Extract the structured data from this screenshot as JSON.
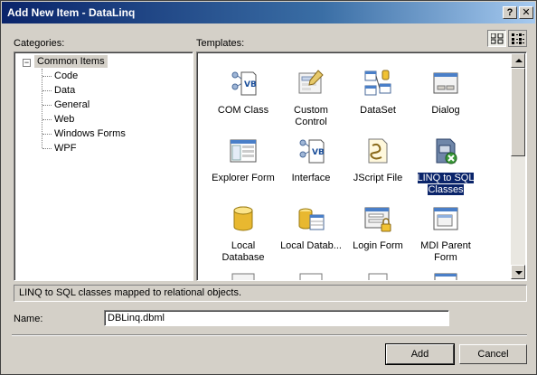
{
  "window": {
    "title": "Add New Item - DataLinq",
    "help_label": "?",
    "close_label": "✕"
  },
  "categories": {
    "label": "Categories:",
    "root": {
      "toggle": "−",
      "label": "Common Items"
    },
    "items": [
      {
        "label": "Code"
      },
      {
        "label": "Data"
      },
      {
        "label": "General"
      },
      {
        "label": "Web"
      },
      {
        "label": "Windows Forms"
      },
      {
        "label": "WPF"
      }
    ]
  },
  "templates": {
    "label": "Templates:",
    "view_modes": [
      "large-icons",
      "small-icons"
    ],
    "selected": "LINQ to SQL Classes",
    "items": [
      {
        "label": "COM Class",
        "icon": "vb-class-icon"
      },
      {
        "label": "Custom Control",
        "icon": "custom-control-icon"
      },
      {
        "label": "DataSet",
        "icon": "dataset-icon"
      },
      {
        "label": "Dialog",
        "icon": "dialog-icon"
      },
      {
        "label": "Explorer Form",
        "icon": "explorer-form-icon"
      },
      {
        "label": "Interface",
        "icon": "interface-icon"
      },
      {
        "label": "JScript File",
        "icon": "jscript-file-icon"
      },
      {
        "label": "LINQ to SQL Classes",
        "icon": "linq-to-sql-icon"
      },
      {
        "label": "Local Database",
        "icon": "local-database-icon"
      },
      {
        "label": "Local Datab...",
        "icon": "local-database-cache-icon"
      },
      {
        "label": "Login Form",
        "icon": "login-form-icon"
      },
      {
        "label": "MDI Parent Form",
        "icon": "mdi-parent-form-icon"
      }
    ]
  },
  "description": "LINQ to SQL classes mapped to relational objects.",
  "name_field": {
    "label": "Name:",
    "value": "DBLinq.dbml"
  },
  "buttons": {
    "add": "Add",
    "cancel": "Cancel"
  },
  "colors": {
    "selection": "#0a246a",
    "face": "#d4d0c8",
    "titlebar_start": "#0a246a",
    "titlebar_end": "#a6caf0"
  }
}
